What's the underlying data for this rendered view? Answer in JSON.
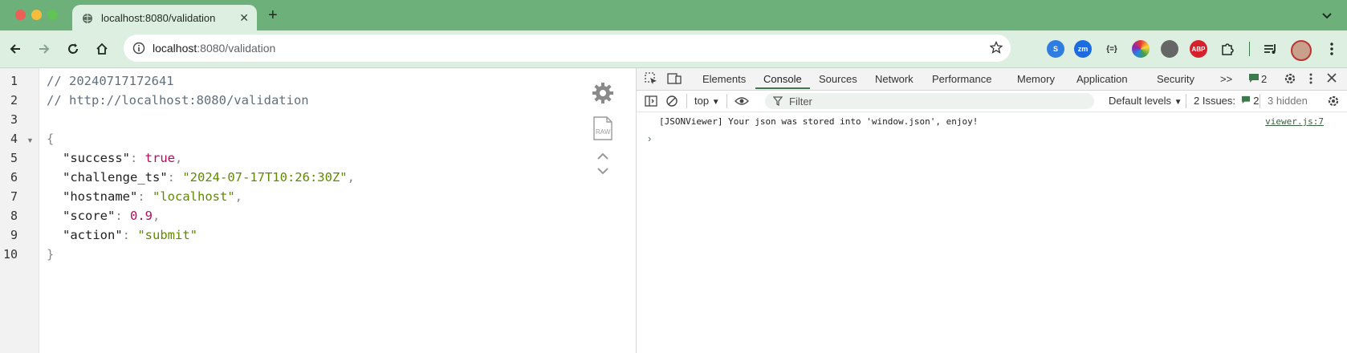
{
  "browser": {
    "tab_title": "localhost:8080/validation",
    "url_host": "localhost",
    "url_rest": ":8080/validation",
    "colors": {
      "chrome_bg": "#6db07a",
      "toolbar_bg": "#dcefe0"
    },
    "extensions": [
      {
        "name": "sync-extension",
        "icon": "s-swirl-icon",
        "label": "S",
        "color": "#2f7de1"
      },
      {
        "name": "zoom-extension",
        "icon": "zoom-icon",
        "label": "zm",
        "color": "#1c6be0"
      },
      {
        "name": "json-extension",
        "icon": "braces-icon",
        "label": "{=}",
        "color": "#2b2b2b"
      },
      {
        "name": "color-extension",
        "icon": "color-wheel-icon",
        "label": "",
        "color": "#c23ad6"
      },
      {
        "name": "dev-extension",
        "icon": "dev-icon",
        "label": "",
        "color": "#444"
      },
      {
        "name": "adblock-extension",
        "icon": "abp-icon",
        "label": "ABP",
        "color": "#d6202b"
      }
    ]
  },
  "json_view": {
    "line_numbers": [
      "1",
      "2",
      "3",
      "4",
      "5",
      "6",
      "7",
      "8",
      "9",
      "10"
    ],
    "comment_time": "// 20240717172641",
    "comment_url": "// http://localhost:8080/validation",
    "open_brace": "{",
    "close_brace": "}",
    "entries": [
      {
        "key": "\"success\"",
        "value": "true",
        "type": "bool",
        "comma": ","
      },
      {
        "key": "\"challenge_ts\"",
        "value": "\"2024-07-17T10:26:30Z\"",
        "type": "string",
        "comma": ","
      },
      {
        "key": "\"hostname\"",
        "value": "\"localhost\"",
        "type": "string",
        "comma": ","
      },
      {
        "key": "\"score\"",
        "value": "0.9",
        "type": "number",
        "comma": ","
      },
      {
        "key": "\"action\"",
        "value": "\"submit\"",
        "type": "string",
        "comma": ""
      }
    ],
    "raw_label": "RAW"
  },
  "devtools": {
    "tabs": [
      "Elements",
      "Console",
      "Sources",
      "Network",
      "Performance",
      "Memory",
      "Application",
      "Security"
    ],
    "active_tab": "Console",
    "more_tabs": ">>",
    "message_count": "2",
    "context": "top",
    "filter_placeholder": "Filter",
    "levels": "Default levels",
    "issues_label": "2 Issues:",
    "issues_count": "2",
    "hidden_label": "3 hidden",
    "console_message": "[JSONViewer] Your json was stored into 'window.json', enjoy!",
    "console_source": "viewer.js:7",
    "prompt_symbol": "›"
  }
}
